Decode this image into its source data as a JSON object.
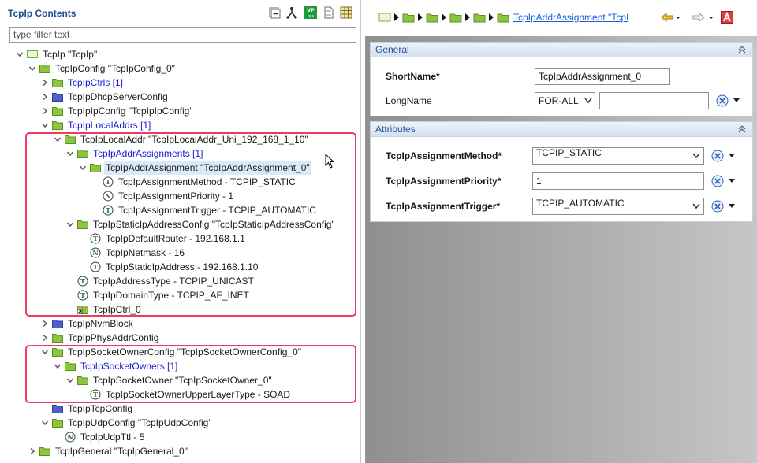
{
  "left_panel": {
    "title": "TcpIp Contents",
    "filter_placeholder": "type filter text",
    "toolbar": {
      "vp_label_top": "VP",
      "vp_label_bottom": "res"
    },
    "tree": [
      {
        "label": "TcpIp \"TcpIp\"",
        "depth": 0,
        "icon": "module-icon",
        "expanded": true
      },
      {
        "label": "TcpIpConfig \"TcpIpConfig_0\"",
        "depth": 1,
        "icon": "folder-icon",
        "expanded": true
      },
      {
        "label": "TcpIpCtrls [1]",
        "depth": 2,
        "icon": "folder-icon",
        "expanded": false,
        "link": true
      },
      {
        "label": "TcpIpDhcpServerConfig",
        "depth": 2,
        "icon": "folder-blue-icon",
        "expanded": false
      },
      {
        "label": "TcpIpIpConfig \"TcpIpIpConfig\"",
        "depth": 2,
        "icon": "folder-icon",
        "expanded": false
      },
      {
        "label": "TcpIpLocalAddrs [1]",
        "depth": 2,
        "icon": "folder-icon",
        "expanded": true,
        "link": true
      },
      {
        "label": "TcpIpLocalAddr \"TcpIpLocalAddr_Uni_192_168_1_10\"",
        "depth": 3,
        "icon": "folder-icon",
        "expanded": true
      },
      {
        "label": "TcpIpAddrAssignments [1]",
        "depth": 4,
        "icon": "folder-icon",
        "expanded": true,
        "link": true
      },
      {
        "label": "TcpIpAddrAssignment \"TcpIpAddrAssignment_0\"",
        "depth": 5,
        "icon": "folder-icon",
        "expanded": true,
        "selected": true
      },
      {
        "label": "TcpIpAssignmentMethod - TCPIP_STATIC",
        "depth": 6,
        "icon": "text-param-icon",
        "glyph": "T"
      },
      {
        "label": "TcpIpAssignmentPriority - 1",
        "depth": 6,
        "icon": "number-param-icon",
        "glyph": "N"
      },
      {
        "label": "TcpIpAssignmentTrigger - TCPIP_AUTOMATIC",
        "depth": 6,
        "icon": "text-param-icon",
        "glyph": "T"
      },
      {
        "label": "TcpIpStaticIpAddressConfig \"TcpIpStaticIpAddressConfig\"",
        "depth": 4,
        "icon": "folder-icon",
        "expanded": true
      },
      {
        "label": "TcpIpDefaultRouter - 192.168.1.1",
        "depth": 5,
        "icon": "text-param-icon",
        "glyph": "T"
      },
      {
        "label": "TcpIpNetmask - 16",
        "depth": 5,
        "icon": "number-param-icon",
        "glyph": "N"
      },
      {
        "label": "TcpIpStaticIpAddress - 192.168.1.10",
        "depth": 5,
        "icon": "text-param-icon",
        "glyph": "T"
      },
      {
        "label": "TcpIpAddressType - TCPIP_UNICAST",
        "depth": 4,
        "icon": "text-param-icon",
        "glyph": "T"
      },
      {
        "label": "TcpIpDomainType - TCPIP_AF_INET",
        "depth": 4,
        "icon": "text-param-icon",
        "glyph": "T"
      },
      {
        "label": "TcpIpCtrl_0",
        "depth": 4,
        "icon": "reference-folder-icon"
      },
      {
        "label": "TcpIpNvmBlock",
        "depth": 2,
        "icon": "folder-blue-icon",
        "expanded": false
      },
      {
        "label": "TcpIpPhysAddrConfig",
        "depth": 2,
        "icon": "folder-icon",
        "expanded": false
      },
      {
        "label": "TcpIpSocketOwnerConfig \"TcpIpSocketOwnerConfig_0\"",
        "depth": 2,
        "icon": "folder-icon",
        "expanded": true
      },
      {
        "label": "TcpIpSocketOwners [1]",
        "depth": 3,
        "icon": "folder-icon",
        "expanded": true,
        "link": true
      },
      {
        "label": "TcpIpSocketOwner \"TcpIpSocketOwner_0\"",
        "depth": 4,
        "icon": "folder-icon",
        "expanded": true
      },
      {
        "label": "TcpIpSocketOwnerUpperLayerType - SOAD",
        "depth": 5,
        "icon": "text-param-icon",
        "glyph": "T"
      },
      {
        "label": "TcpIpTcpConfig",
        "depth": 2,
        "icon": "folder-blue-icon"
      },
      {
        "label": "TcpIpUdpConfig \"TcpIpUdpConfig\"",
        "depth": 2,
        "icon": "folder-icon",
        "expanded": true
      },
      {
        "label": "TcpIpUdpTtl - 5",
        "depth": 3,
        "icon": "number-param-icon",
        "glyph": "N"
      },
      {
        "label": "TcpIpGeneral \"TcpIpGeneral_0\"",
        "depth": 1,
        "icon": "folder-icon",
        "expanded": false
      }
    ]
  },
  "right_panel": {
    "breadcrumb_link": "TcpIpAddrAssignment \"TcpI",
    "general": {
      "title": "General",
      "short_name_label": "ShortName*",
      "short_name_value": "TcpIpAddrAssignment_0",
      "long_name_label": "LongName",
      "long_name_lang": "FOR-ALL",
      "long_name_value": ""
    },
    "attributes": {
      "title": "Attributes",
      "method_label": "TcpIpAssignmentMethod*",
      "method_value": "TCPIP_STATIC",
      "priority_label": "TcpIpAssignmentPriority*",
      "priority_value": "1",
      "trigger_label": "TcpIpAssignmentTrigger*",
      "trigger_value": "TCPIP_AUTOMATIC"
    }
  },
  "colors": {
    "accent_blue": "#1a5fd6",
    "link_blue": "#1a1ad4",
    "highlight_pink": "#f03a62",
    "folder_green": "#8cc63f",
    "folder_blue": "#4c62c9"
  }
}
